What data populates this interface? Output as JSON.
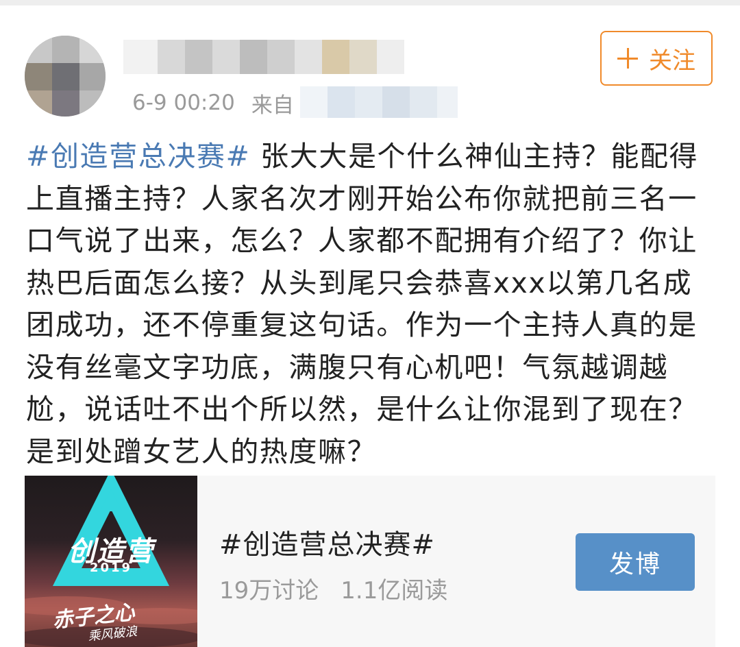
{
  "post": {
    "author": {
      "name": "",
      "avatar_icon": "avatar-pixelated"
    },
    "time": "6-9 00:20",
    "source_prefix": "来自",
    "follow_label": "关注",
    "hashtag": "#创造营总决赛#",
    "body": " 张大大是个什么神仙主持？能配得上直播主持？人家名次才刚开始公布你就把前三名一口气说了出来，怎么？人家都不配拥有介绍了？你让热巴后面怎么接？从头到尾只会恭喜xxx以第几名成团成功，还不停重复这句话。作为一个主持人真的是没有丝毫文字功底，满腹只有心机吧！气氛越调越尬，说话吐不出个所以然，是什么让你混到了现在？是到处蹭女艺人的热度嘛？"
  },
  "topic_card": {
    "thumb": {
      "title": "创造营",
      "year": "2019",
      "slogan_line1": "乘风破浪",
      "slogan_line2": "赤子之心"
    },
    "title": "#创造营总决赛#",
    "discussions": "19万讨论",
    "reads": "1.1亿阅读",
    "post_button": "发博"
  },
  "colors": {
    "accent_orange": "#f08a2a",
    "hashtag_blue": "#4a7ab3",
    "button_blue": "#5790c8",
    "meta_gray": "#9a9a9a"
  }
}
